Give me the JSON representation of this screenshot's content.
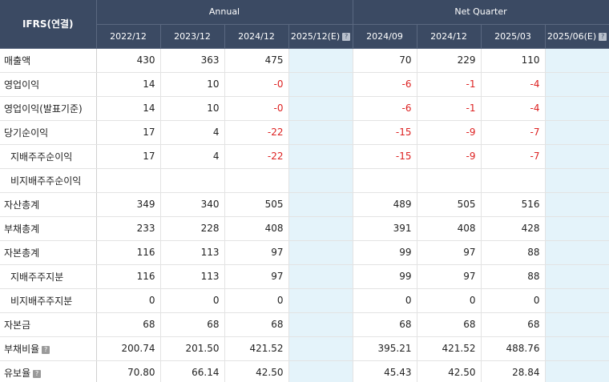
{
  "header": {
    "corner": "IFRS(연결)",
    "groups": [
      "Annual",
      "Net Quarter"
    ],
    "periods": [
      "2022/12",
      "2023/12",
      "2024/12",
      "2025/12(E)",
      "2024/09",
      "2024/12",
      "2025/03",
      "2025/06(E)"
    ]
  },
  "rows": [
    {
      "label": "매출액",
      "values": [
        "430",
        "363",
        "475",
        "",
        "70",
        "229",
        "110",
        ""
      ]
    },
    {
      "label": "영업이익",
      "values": [
        "14",
        "10",
        "-0",
        "",
        "-6",
        "-1",
        "-4",
        ""
      ]
    },
    {
      "label": "영업이익(발표기준)",
      "values": [
        "14",
        "10",
        "-0",
        "",
        "-6",
        "-1",
        "-4",
        ""
      ]
    },
    {
      "label": "당기순이익",
      "values": [
        "17",
        "4",
        "-22",
        "",
        "-15",
        "-9",
        "-7",
        ""
      ]
    },
    {
      "label": "지배주주순이익",
      "values": [
        "17",
        "4",
        "-22",
        "",
        "-15",
        "-9",
        "-7",
        ""
      ]
    },
    {
      "label": "비지배주주순이익",
      "values": [
        "",
        "",
        "",
        "",
        "",
        "",
        "",
        ""
      ]
    },
    {
      "label": "자산총계",
      "values": [
        "349",
        "340",
        "505",
        "",
        "489",
        "505",
        "516",
        ""
      ]
    },
    {
      "label": "부채총계",
      "values": [
        "233",
        "228",
        "408",
        "",
        "391",
        "408",
        "428",
        ""
      ]
    },
    {
      "label": "자본총계",
      "values": [
        "116",
        "113",
        "97",
        "",
        "99",
        "97",
        "88",
        ""
      ]
    },
    {
      "label": "지배주주지분",
      "values": [
        "116",
        "113",
        "97",
        "",
        "99",
        "97",
        "88",
        ""
      ]
    },
    {
      "label": "비지배주주지분",
      "values": [
        "0",
        "0",
        "0",
        "",
        "0",
        "0",
        "0",
        ""
      ]
    },
    {
      "label": "자본금",
      "values": [
        "68",
        "68",
        "68",
        "",
        "68",
        "68",
        "68",
        ""
      ]
    },
    {
      "label": "부채비율",
      "values": [
        "200.74",
        "201.50",
        "421.52",
        "",
        "395.21",
        "421.52",
        "488.76",
        ""
      ]
    },
    {
      "label": "유보율",
      "values": [
        "70.80",
        "66.14",
        "42.50",
        "",
        "45.43",
        "42.50",
        "28.84",
        ""
      ]
    }
  ],
  "icons": {
    "help": "question-mark-help-icon"
  },
  "colors": {
    "header_bg": "#3b4a63",
    "estimate_bg": "#e4f3fa",
    "negative": "#dd2222"
  }
}
